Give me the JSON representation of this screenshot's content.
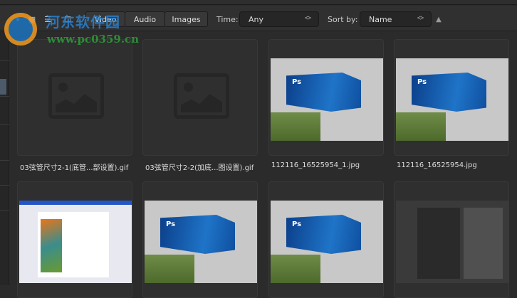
{
  "toolbar": {
    "view_icons": [
      "grid-view-icon",
      "list-view-icon",
      "single-view-icon"
    ],
    "filters": [
      "Video",
      "Audio",
      "Images"
    ],
    "time_label": "Time:",
    "time_value": "Any",
    "sort_label": "Sort by:",
    "sort_value": "Name",
    "sort_direction": "ascending"
  },
  "items": [
    {
      "name": "03弦管尺寸2-1(底管...部设置).gif",
      "thumb": "placeholder"
    },
    {
      "name": "03弦管尺寸2-2(加底...图设置).gif",
      "thumb": "placeholder"
    },
    {
      "name": "112116_16525954_1.jpg",
      "thumb": "photoshop"
    },
    {
      "name": "112116_16525954.jpg",
      "thumb": "photoshop"
    },
    {
      "name": "",
      "thumb": "photoshop-old"
    },
    {
      "name": "",
      "thumb": "photoshop"
    },
    {
      "name": "",
      "thumb": "photoshop"
    },
    {
      "name": "",
      "thumb": "photoshop-dark"
    }
  ],
  "watermark": {
    "title": "河东软件园",
    "url": "www.pc0359.cn"
  }
}
